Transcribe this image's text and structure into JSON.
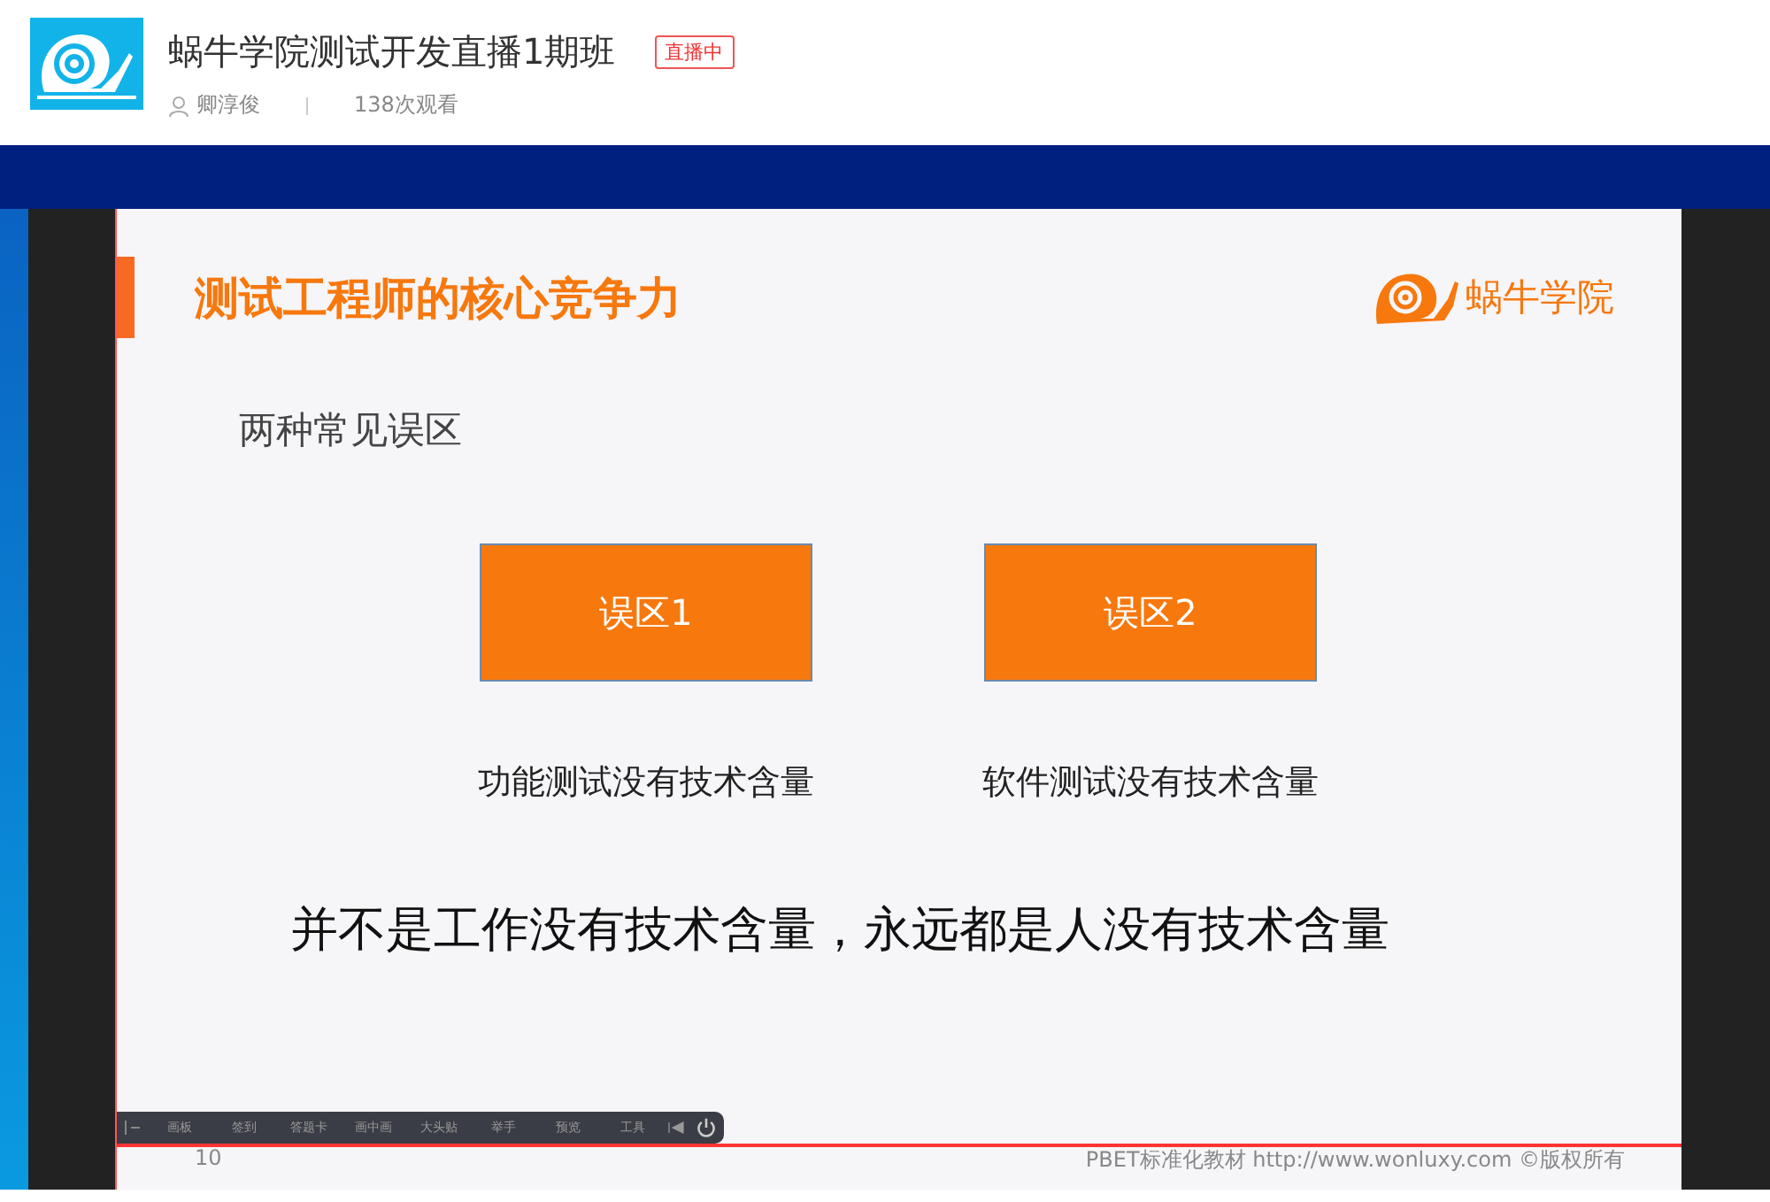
{
  "header": {
    "title": "蜗牛学院测试开发直播1期班",
    "live_badge": "直播中",
    "author": "卿淳俊",
    "views": "138次观看"
  },
  "slide": {
    "title": "测试工程师的核心竞争力",
    "logo_text": "蜗牛学院",
    "subtitle": "两种常见误区",
    "boxes": [
      {
        "label": "误区1",
        "caption": "功能测试没有技术含量"
      },
      {
        "label": "误区2",
        "caption": "软件测试没有技术含量"
      }
    ],
    "conclusion": "并不是工作没有技术含量，永远都是人没有技术含量",
    "page_number": "10",
    "footer": "PBET标准化教材  http://www.wonluxy.com ©版权所有"
  },
  "toolbar": {
    "items": [
      "画板",
      "签到",
      "答题卡",
      "画中画",
      "大头贴",
      "举手",
      "预览",
      "工具"
    ]
  }
}
